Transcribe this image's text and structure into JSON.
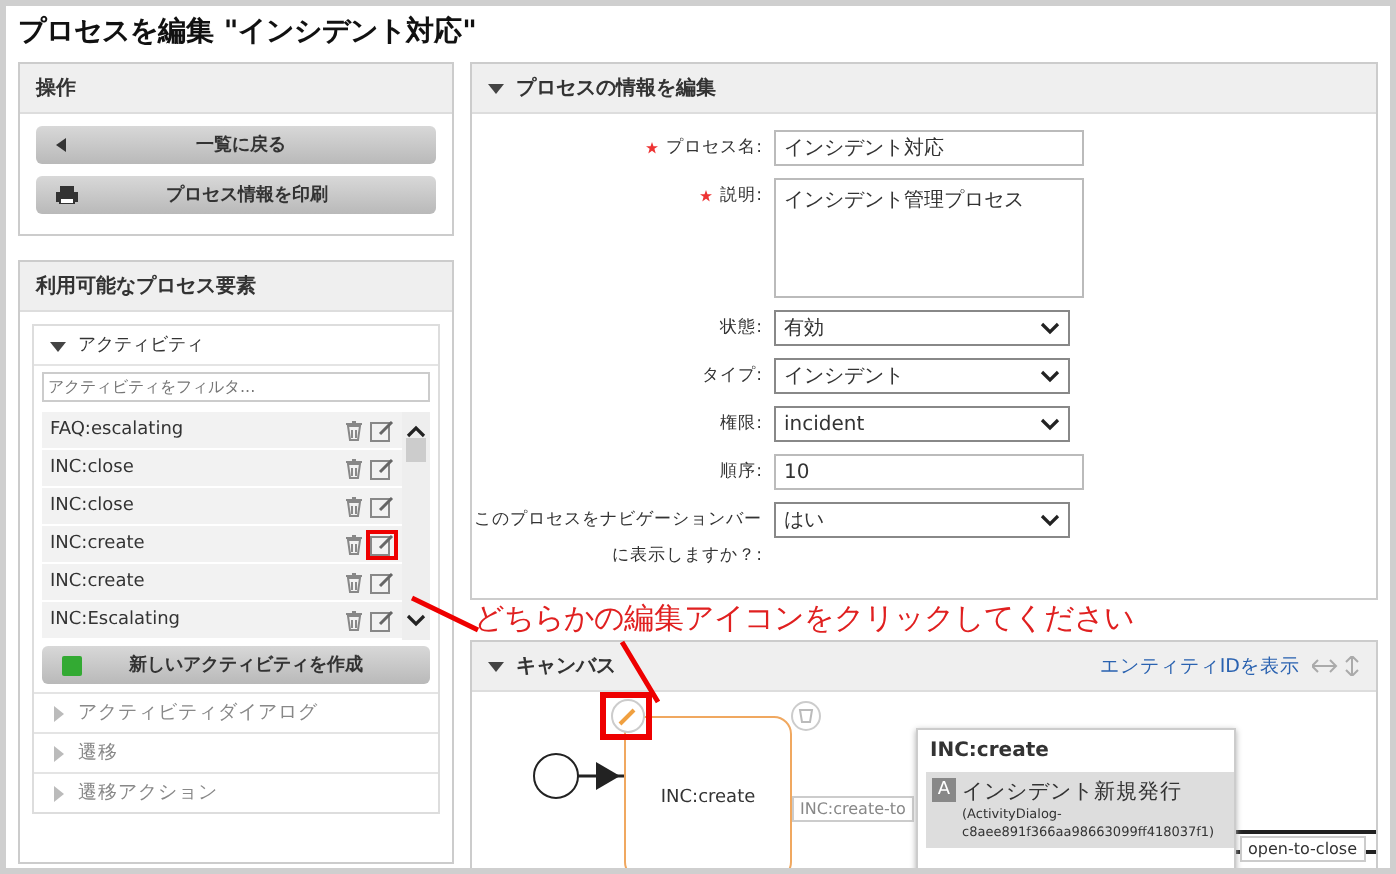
{
  "window": {
    "title": "プロセスを編集 \"インシデント対応\""
  },
  "operations": {
    "title": "操作",
    "buttons": [
      {
        "label": "一覧に戻る",
        "kind": "back"
      },
      {
        "label": "プロセス情報を印刷",
        "kind": "print"
      }
    ]
  },
  "elements": {
    "title": "利用可能なプロセス要素",
    "activities": {
      "title": "アクティビティ",
      "expanded": true,
      "filter_placeholder": "アクティビティをフィルタ...",
      "items": [
        {
          "name": "FAQ:escalating",
          "highlighted": false
        },
        {
          "name": "INC:close",
          "highlighted": false
        },
        {
          "name": "INC:close",
          "highlighted": false
        },
        {
          "name": "INC:create",
          "highlighted": true
        },
        {
          "name": "INC:create",
          "highlighted": false
        },
        {
          "name": "INC:Escalating",
          "highlighted": false
        }
      ],
      "create_button": "新しいアクティビティを作成"
    },
    "sections": [
      {
        "title": "アクティビティダイアログ",
        "expanded": false
      },
      {
        "title": "遷移",
        "expanded": false
      },
      {
        "title": "遷移アクション",
        "expanded": false
      }
    ]
  },
  "process_info": {
    "title": "プロセスの情報を編集",
    "expanded": true,
    "fields": [
      {
        "label": "プロセス名:",
        "required": true,
        "kind": "text",
        "value": "インシデント対応"
      },
      {
        "label": "説明:",
        "required": true,
        "kind": "textarea",
        "value": "インシデント管理プロセス"
      },
      {
        "label": "状態:",
        "required": false,
        "kind": "select",
        "value": "有効"
      },
      {
        "label": "タイプ:",
        "required": false,
        "kind": "select",
        "value": "インシデント"
      },
      {
        "label": "権限:",
        "required": false,
        "kind": "select",
        "value": "incident"
      },
      {
        "label": "順序:",
        "required": false,
        "kind": "text",
        "value": "10"
      },
      {
        "label": "このプロセスをナビゲーションバーに表示しますか？:",
        "required": false,
        "kind": "select",
        "value": "はい"
      }
    ]
  },
  "annotation": "どちらかの編集アイコンをクリックしてください",
  "canvas": {
    "title": "キャンバス",
    "expanded": true,
    "show_ids_link": "エンティティIDを表示",
    "node": {
      "label": "INC:create"
    },
    "edge_labels": [
      "INC:create-to",
      "open-to-close"
    ],
    "popup": {
      "title": "INC:create",
      "badge": "A",
      "item_title": "インシデント新規発行",
      "item_detail": "(ActivityDialog-\nc8aee891f366aa98663099ff418037f1)"
    }
  }
}
